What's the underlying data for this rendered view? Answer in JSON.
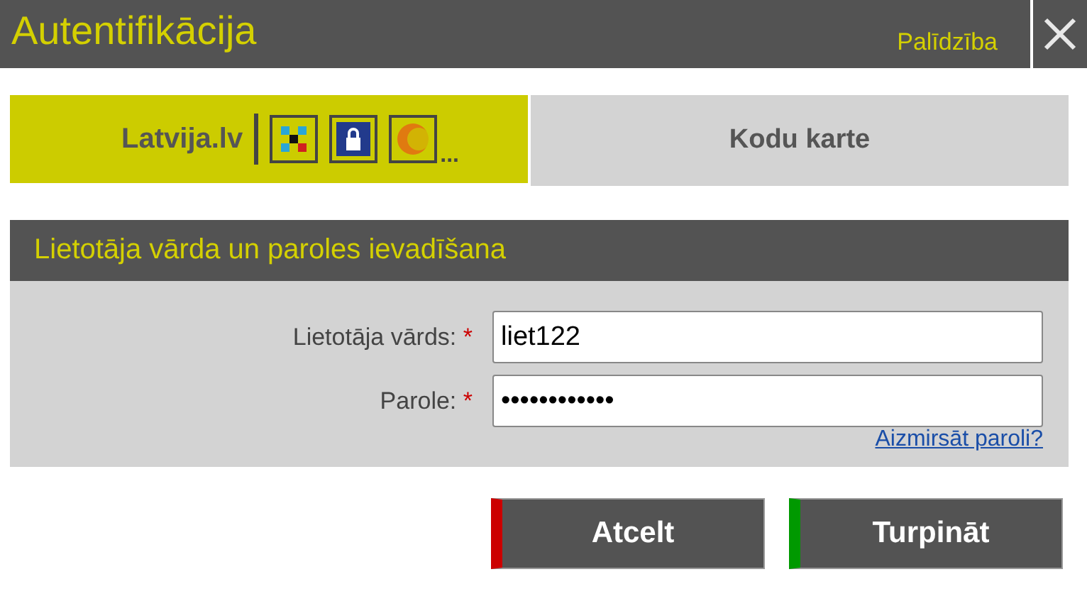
{
  "window": {
    "title": "Autentifikācija",
    "help_link": "Palīdzība"
  },
  "tabs": [
    {
      "kind": "logo",
      "label": "Latvija.lv",
      "more": "...",
      "selected": true
    },
    {
      "kind": "text",
      "label": "Kodu karte",
      "selected": false
    }
  ],
  "section": {
    "title": "Lietotāja vārda un paroles ievadīšana"
  },
  "fields": [
    {
      "label": "Lietotāja vārds:",
      "marker": "*",
      "value": "liet122"
    },
    {
      "label": "Parole:",
      "marker": "*",
      "value": "••••••••••••"
    }
  ],
  "forgot_link": "Aizmirsāt paroli?",
  "buttons": [
    {
      "label": "Atcelt",
      "color": "#cc0000"
    },
    {
      "label": "Turpināt",
      "color": "#009900"
    }
  ]
}
